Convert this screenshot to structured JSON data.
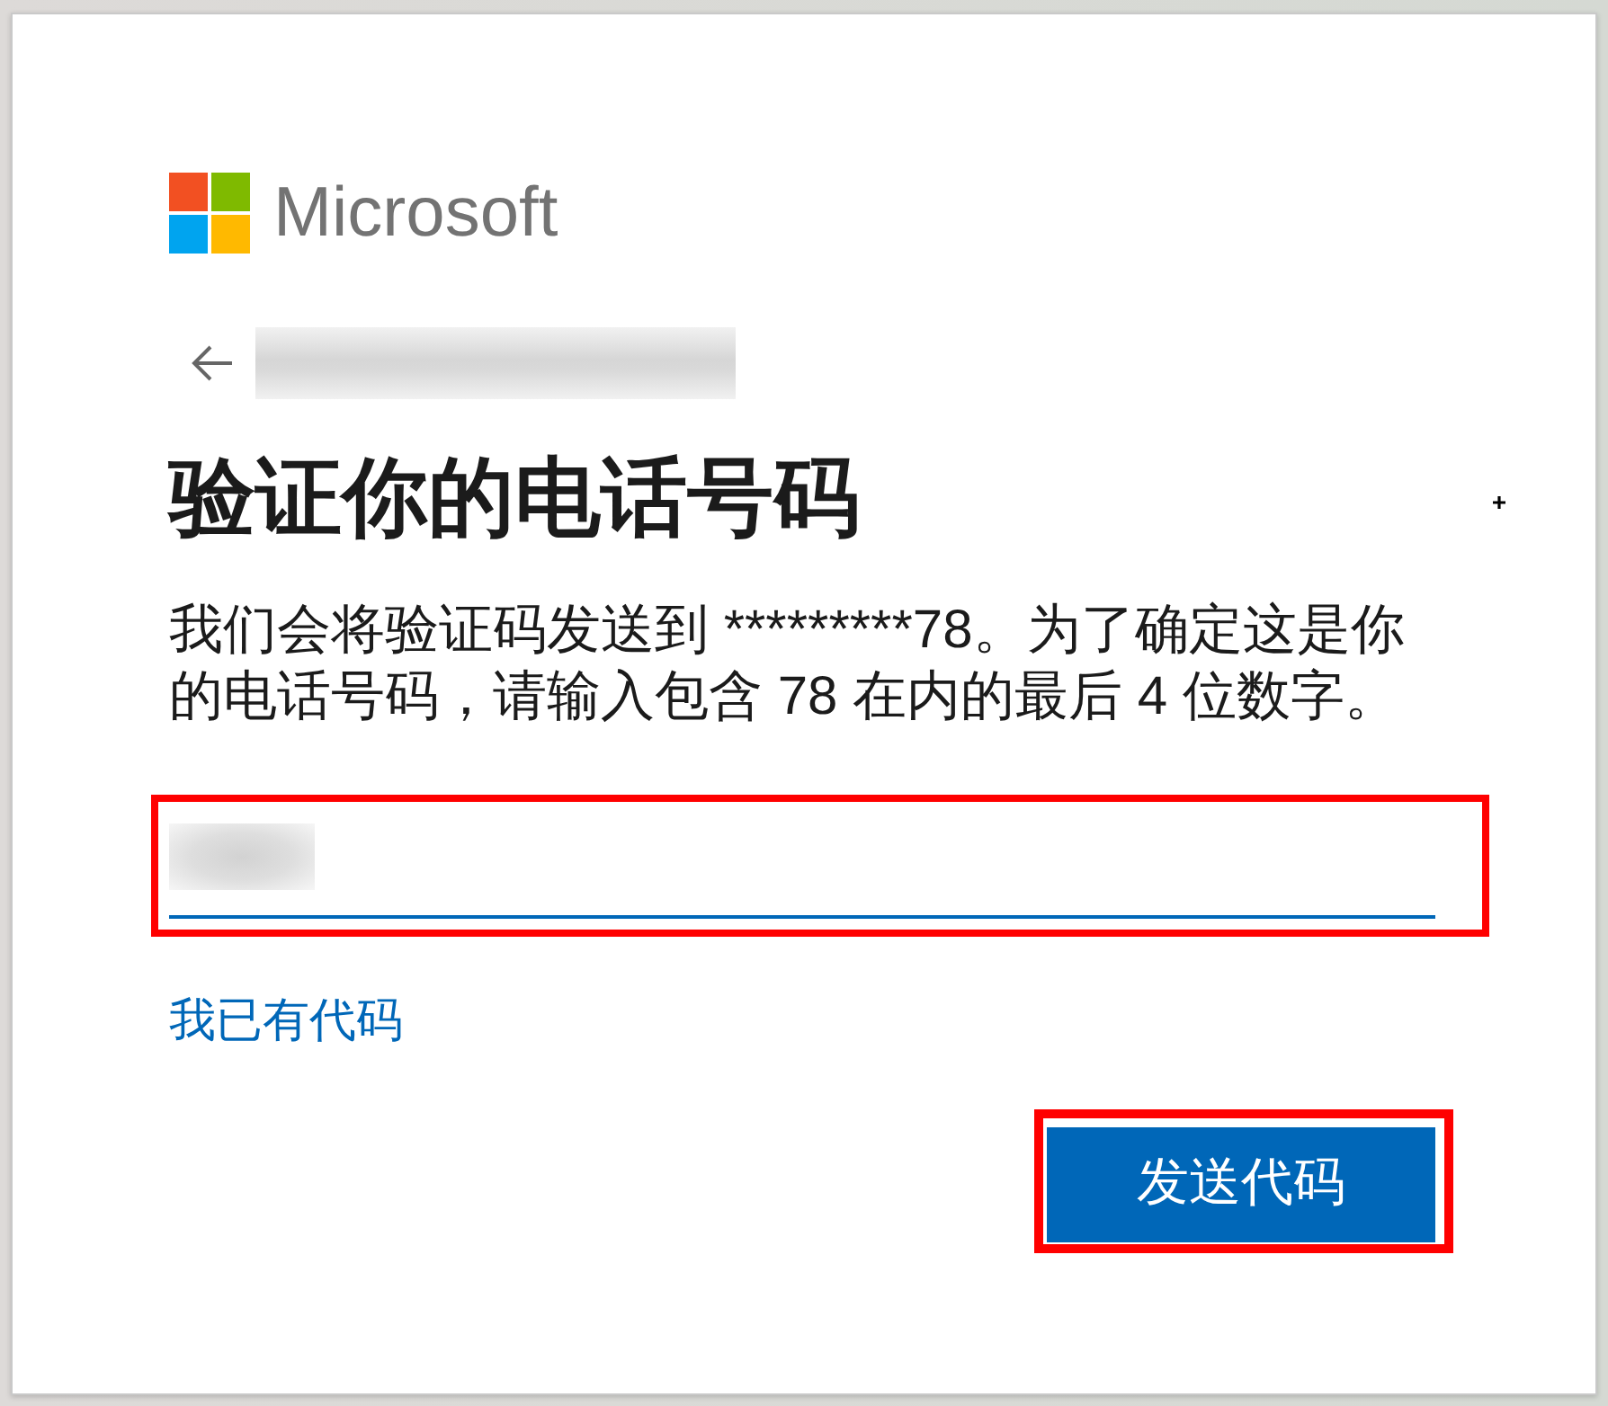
{
  "brand": {
    "name": "Microsoft"
  },
  "heading": "验证你的电话号码",
  "description": "我们会将验证码发送到 *********78。为了确定这是你的电话号码，请输入包含 78 在内的最后 4 位数字。",
  "code_field": {
    "focused": true,
    "highlighted": true
  },
  "links": [
    {
      "label": "我已有代码"
    }
  ],
  "buttons": [
    {
      "label": "发送代码",
      "kind": "primary",
      "highlighted": true
    }
  ]
}
